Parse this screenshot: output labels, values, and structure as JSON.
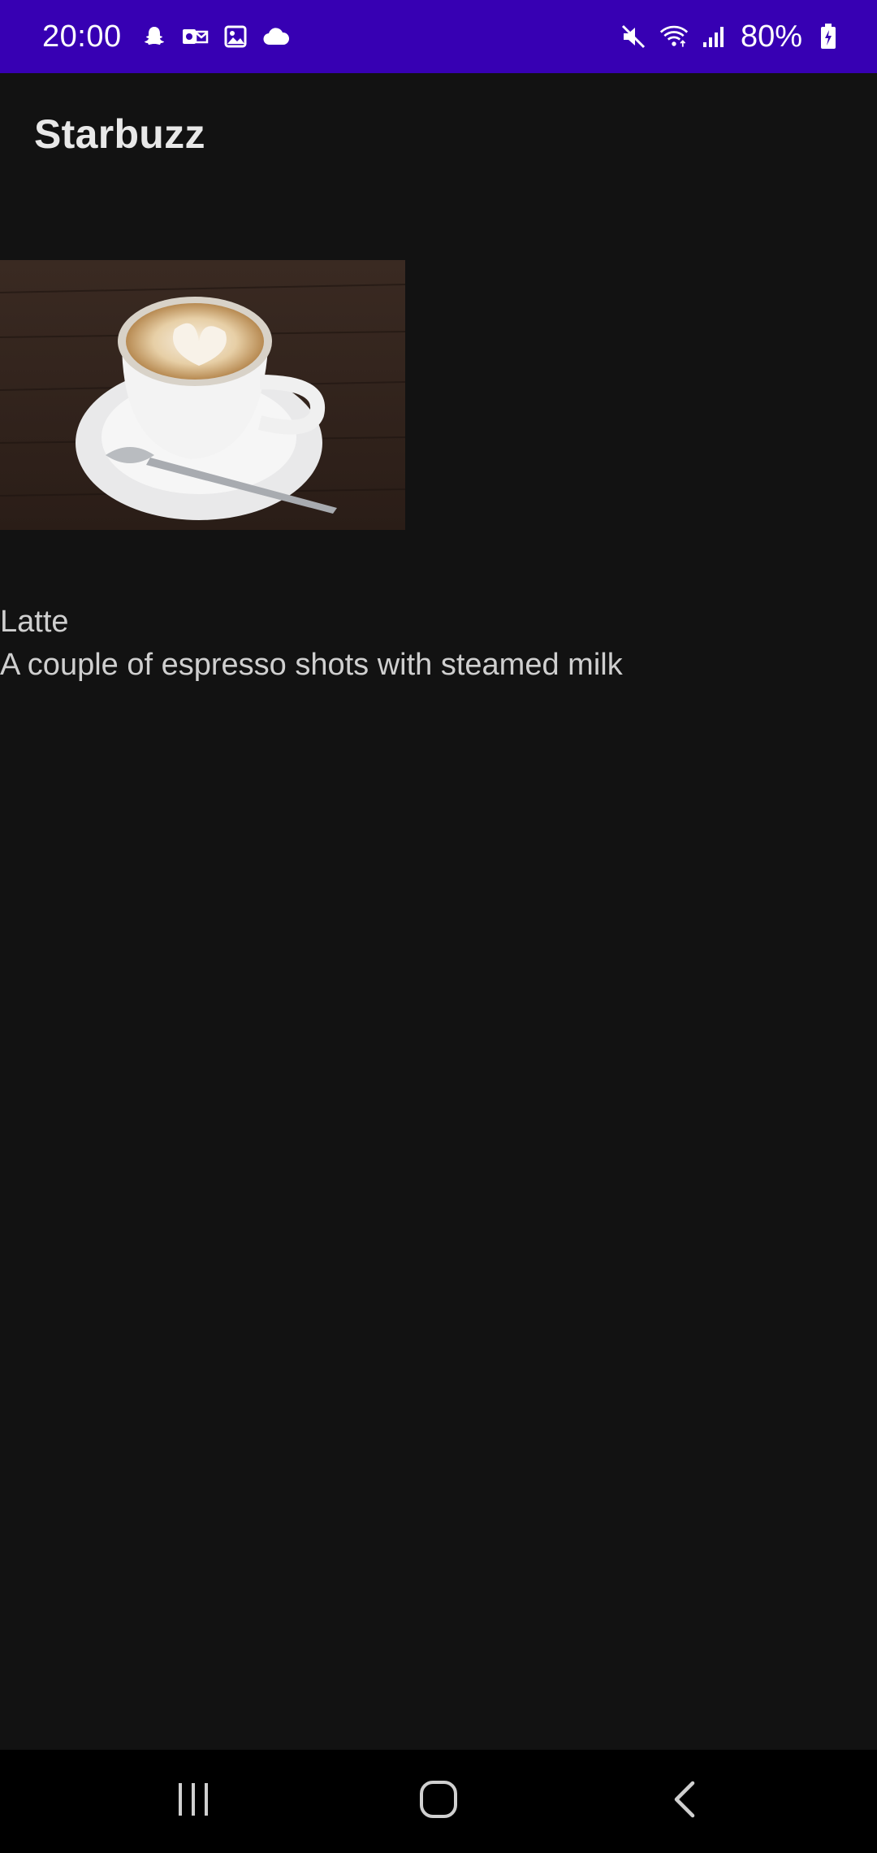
{
  "status_bar": {
    "time": "20:00",
    "battery": "80%",
    "left_icons": [
      "snapchat-icon",
      "outlook-icon",
      "gallery-icon",
      "cloud-icon"
    ],
    "right_icons": [
      "mute-icon",
      "wifi-icon",
      "signal-icon",
      "battery-icon"
    ],
    "background": "#3700b3"
  },
  "app_bar": {
    "title": "Starbuzz"
  },
  "drink": {
    "name": "Latte",
    "description": "A couple of espresso shots with steamed milk",
    "image": "latte-photo"
  },
  "nav_bar": {
    "buttons": [
      "recent-apps",
      "home",
      "back"
    ]
  },
  "colors": {
    "background": "#121212",
    "text": "#cfcfcf",
    "title": "#e8e8e8"
  }
}
